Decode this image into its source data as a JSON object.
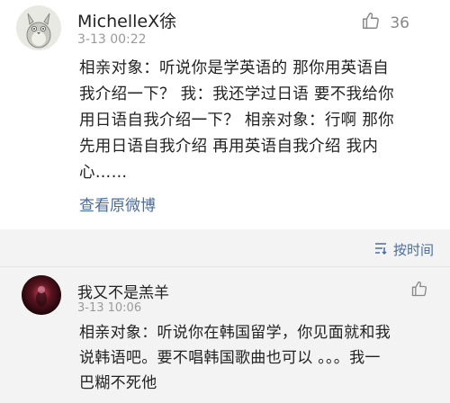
{
  "post": {
    "username": "MichelleX徐",
    "timestamp": "3-13 00:22",
    "like_count": "36",
    "lines": [
      "相亲对象：听说你是学英语的 那你用英语自",
      "我介绍一下？ 我：我还学过日语 要不我给你",
      "用日语自我介绍一下？ 相亲对象：行啊 那你",
      "先用日语自我介绍 再用英语自我介绍 我内",
      "心……"
    ],
    "view_original_label": "查看原微博",
    "avatar_icon": "totoro-avatar-icon"
  },
  "comments": {
    "sort_label": "按时间",
    "sort_icon": "sort-icon",
    "items": [
      {
        "username": "我又不是羔羊",
        "timestamp": "3-13 10:06",
        "lines": [
          "相亲对象：听说你在韩国留学，你见面就和我",
          "说韩语吧。要不唱韩国歌曲也可以 。。。我一",
          "巴糊不死他"
        ],
        "avatar_icon": "dark-photo-avatar-icon"
      }
    ]
  },
  "colors": {
    "link": "#4c6c99",
    "muted": "#9a9a9a",
    "section_bg": "#f3f3f3"
  }
}
